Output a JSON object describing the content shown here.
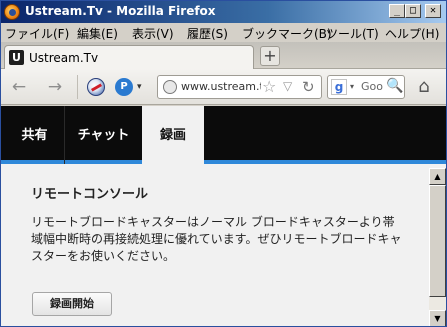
{
  "window": {
    "title": "Ustream.Tv - Mozilla Firefox",
    "minimize_glyph": "_",
    "maximize_glyph": "□",
    "close_glyph": "✕"
  },
  "menubar": {
    "items": [
      {
        "label": "ファイル(F)"
      },
      {
        "label": "編集(E)"
      },
      {
        "label": "表示(V)"
      },
      {
        "label": "履歴(S)"
      },
      {
        "label": "ブックマーク(B)"
      },
      {
        "label": "ツール(T)"
      },
      {
        "label": "ヘルプ(H)"
      }
    ]
  },
  "tabs": {
    "active_title": "Ustream.Tv",
    "favicon_letter": "U",
    "new_tab_glyph": "+"
  },
  "navbar": {
    "back_glyph": "←",
    "forward_glyph": "→",
    "addon2_letter": "P",
    "addon_drop_glyph": "▾",
    "url": "www.ustream.tv",
    "star_glyph": "☆",
    "url_drop_glyph": "▽",
    "reload_glyph": "↻",
    "search_engine_letter": "g",
    "search_drop_glyph": "▾",
    "search_placeholder": "Goo",
    "magnifier_glyph": "🔍",
    "home_glyph": "⌂"
  },
  "page": {
    "nav_tabs": [
      {
        "label": "共有",
        "active": false
      },
      {
        "label": "チャット",
        "active": false
      },
      {
        "label": "録画",
        "active": true
      }
    ],
    "panel_title": "リモートコンソール",
    "panel_description": "リモートブロードキャスターはノーマル ブロードキャスターより帯域幅中断時の再接続処理に優れています。ぜひリモートブロードキャスターをお使いください。",
    "record_button_label": "録画開始"
  },
  "scrollbar": {
    "up_glyph": "▲",
    "down_glyph": "▼"
  },
  "colors": {
    "titlebar_start": "#0a246a",
    "nav_background": "#0b0b0b",
    "nav_accent": "#2f88d9"
  }
}
